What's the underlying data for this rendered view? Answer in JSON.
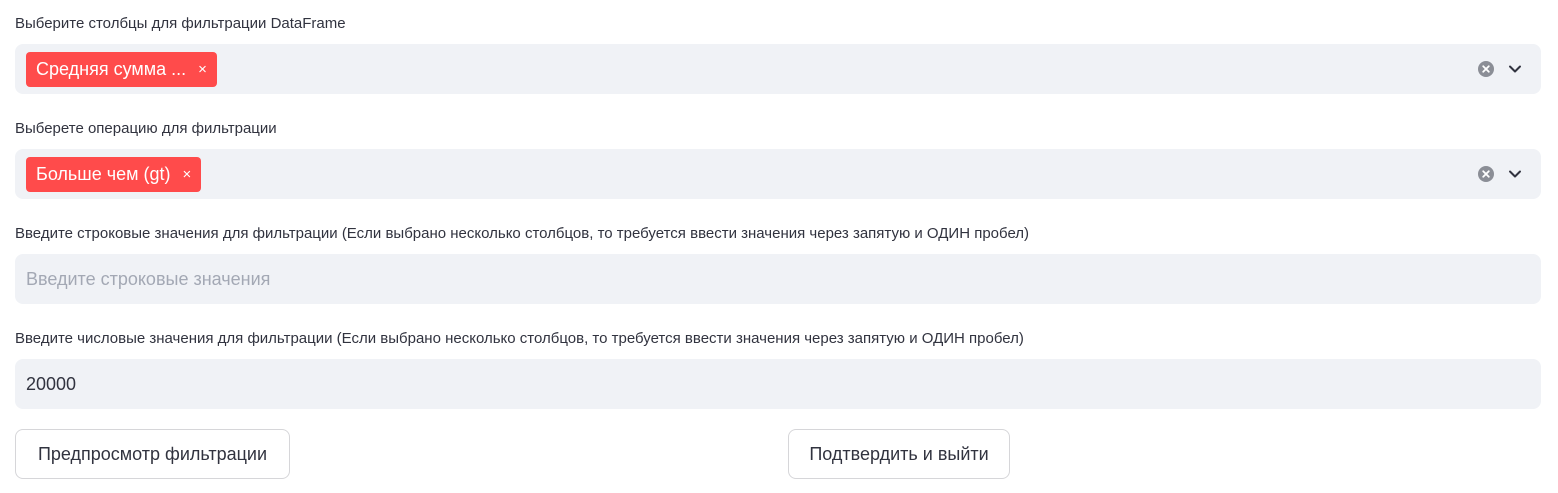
{
  "columns_select": {
    "label": "Выберите столбцы для фильтрации DataFrame",
    "tags": [
      {
        "label": "Средняя сумма ..."
      }
    ],
    "remove_glyph": "×"
  },
  "operation_select": {
    "label": "Выберете операцию для фильтрации",
    "tags": [
      {
        "label": "Больше чем (gt)"
      }
    ],
    "remove_glyph": "×"
  },
  "string_values": {
    "label": "Введите строковые значения для фильтрации (Если выбрано несколько столбцов, то требуется ввести значения через запятую и ОДИН пробел)",
    "value": "",
    "placeholder": "Введите строковые значения"
  },
  "numeric_values": {
    "label": "Введите числовые значения для фильтрации (Если выбрано несколько столбцов, то требуется ввести значения через запятую и ОДИН пробел)",
    "value": "20000",
    "placeholder": ""
  },
  "buttons": {
    "preview_label": "Предпросмотр фильтрации",
    "confirm_label": "Подтвердить и выйти"
  },
  "colors": {
    "accent": "#ff4b4b",
    "field_background": "#f0f2f6",
    "text": "#31333f",
    "placeholder": "#a3a8b4",
    "icon": "#8b8e96"
  },
  "icons": {
    "clear": "clear-circle-x-icon",
    "dropdown": "chevron-down-icon"
  }
}
